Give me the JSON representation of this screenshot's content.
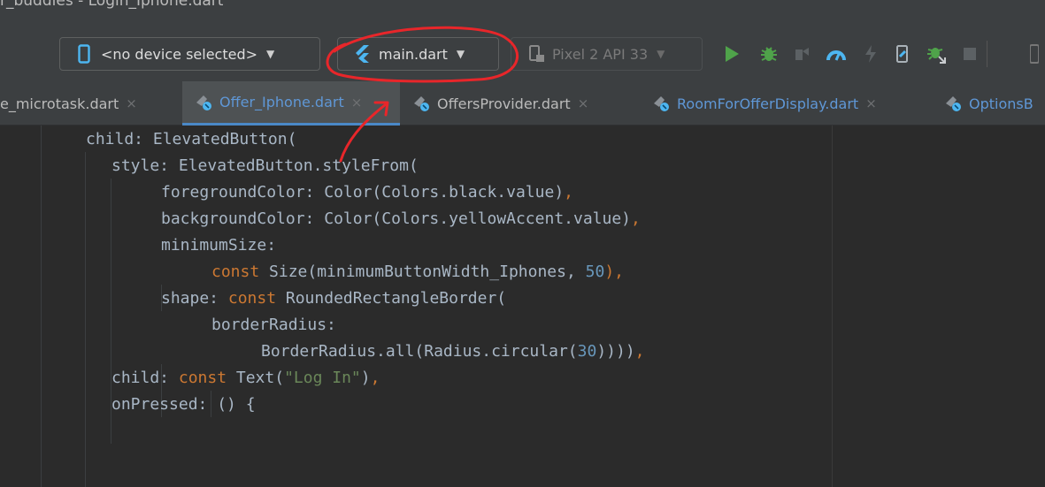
{
  "titlebar": {
    "title": "r_buddies - Login_Iphone.dart"
  },
  "toolbar": {
    "device_select": {
      "label": "<no device selected>"
    },
    "config_select": {
      "label": "main.dart"
    },
    "emulator_select": {
      "label": "Pixel 2 API 33"
    },
    "icons": [
      "phone-icon",
      "flutter-icon",
      "emulator-icon",
      "run-icon",
      "debug-icon",
      "attach-icon",
      "profile-icon",
      "hot-reload-icon",
      "device-manager-icon",
      "attach-debugger-icon",
      "stop-icon"
    ]
  },
  "tabs": [
    {
      "label": "e_microtask.dart",
      "close": "×"
    },
    {
      "label": "Offer_Iphone.dart",
      "close": "×"
    },
    {
      "label": "OffersProvider.dart",
      "close": "×"
    },
    {
      "label": "RoomForOfferDisplay.dart",
      "close": "×"
    },
    {
      "label": "OptionsB",
      "close": ""
    }
  ],
  "code": {
    "l1": {
      "a": "child: ElevatedButton("
    },
    "l2": {
      "a": "style: ElevatedButton.styleFrom("
    },
    "l3": {
      "a": "foregroundColor: Color(Colors.black.value)",
      "b": ","
    },
    "l4": {
      "a": "backgroundColor: Color(Colors.yellowAccent.value)",
      "b": ","
    },
    "l5": {
      "a": "minimumSize:"
    },
    "l6": {
      "k": "const",
      "a": " Size(minimumButtonWidth_Iphones, ",
      "n": "50",
      "b": "),"
    },
    "l7": {
      "a": "shape: ",
      "k": "const",
      "c": " RoundedRectangleBorder("
    },
    "l8": {
      "a": "borderRadius:"
    },
    "l9": {
      "a": "BorderRadius.all(Radius.circular(",
      "n": "30",
      "c": "))))",
      "b": ","
    },
    "l10": {
      "a": "child: ",
      "k": "const",
      "c": " Text(",
      "s": "\"Log In\"",
      "d": ")",
      "b": ","
    },
    "l11": {
      "a": "onPressed: () {"
    }
  },
  "colors": {
    "annotation": "#e8262a",
    "active_tab_underline": "#4a88c7",
    "flutter_blue": "#4db6f1"
  }
}
